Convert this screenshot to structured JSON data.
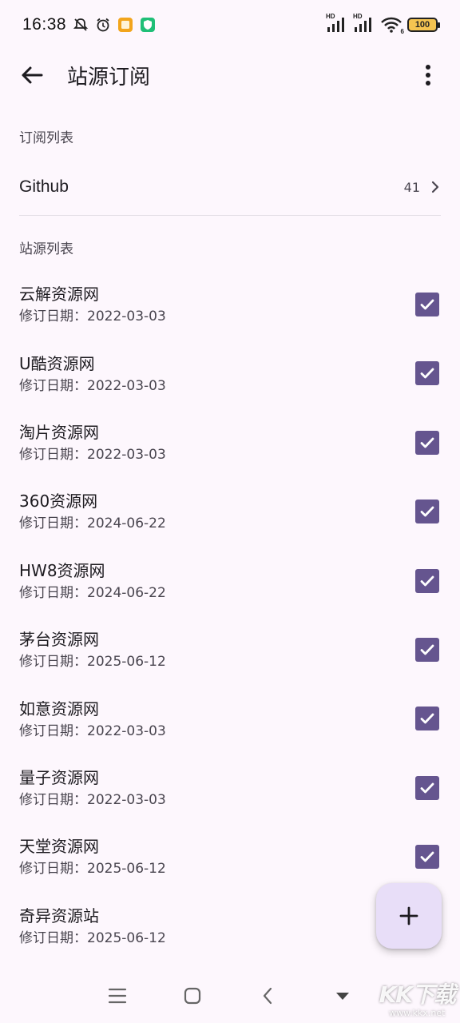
{
  "status_bar": {
    "time": "16:38",
    "battery": "100",
    "network_label": "HD",
    "wifi_badge": "6",
    "icons": [
      "mute-icon",
      "alarm-icon",
      "notes-app-icon",
      "security-app-icon",
      "signal-icon",
      "wifi-icon",
      "battery-icon"
    ]
  },
  "app_bar": {
    "title": "站源订阅",
    "back_icon": "arrow-left-icon",
    "menu_icon": "more-vert-icon"
  },
  "subscriptions": {
    "header": "订阅列表",
    "items": [
      {
        "name": "Github",
        "count": "41"
      }
    ]
  },
  "sites": {
    "header": "站源列表",
    "date_prefix": "修订日期：",
    "items": [
      {
        "name": "云解资源网",
        "date": "修订日期：2022-03-03",
        "checked": true
      },
      {
        "name": "U酷资源网",
        "date": "修订日期：2022-03-03",
        "checked": true
      },
      {
        "name": "淘片资源网",
        "date": "修订日期：2022-03-03",
        "checked": true
      },
      {
        "name": "360资源网",
        "date": "修订日期：2024-06-22",
        "checked": true
      },
      {
        "name": "HW8资源网",
        "date": "修订日期：2024-06-22",
        "checked": true
      },
      {
        "name": "茅台资源网",
        "date": "修订日期：2025-06-12",
        "checked": true
      },
      {
        "name": "如意资源网",
        "date": "修订日期：2022-03-03",
        "checked": true
      },
      {
        "name": "量子资源网",
        "date": "修订日期：2022-03-03",
        "checked": true
      },
      {
        "name": "天堂资源网",
        "date": "修订日期：2025-06-12",
        "checked": true
      },
      {
        "name": "奇异资源站",
        "date": "修订日期：2025-06-12",
        "checked": true
      }
    ]
  },
  "fab": {
    "icon": "plus-icon"
  },
  "nav_bar": {
    "icons": [
      "menu-icon",
      "home-icon",
      "back-icon",
      "keyboard-hide-icon"
    ]
  },
  "watermark": {
    "logo": "KK下载",
    "url": "www.kkx.net"
  },
  "colors": {
    "background": "#fdf7fd",
    "checkbox": "#65558f",
    "fab": "#e8def8",
    "text_primary": "#1d1b20",
    "text_secondary": "#49454f"
  }
}
